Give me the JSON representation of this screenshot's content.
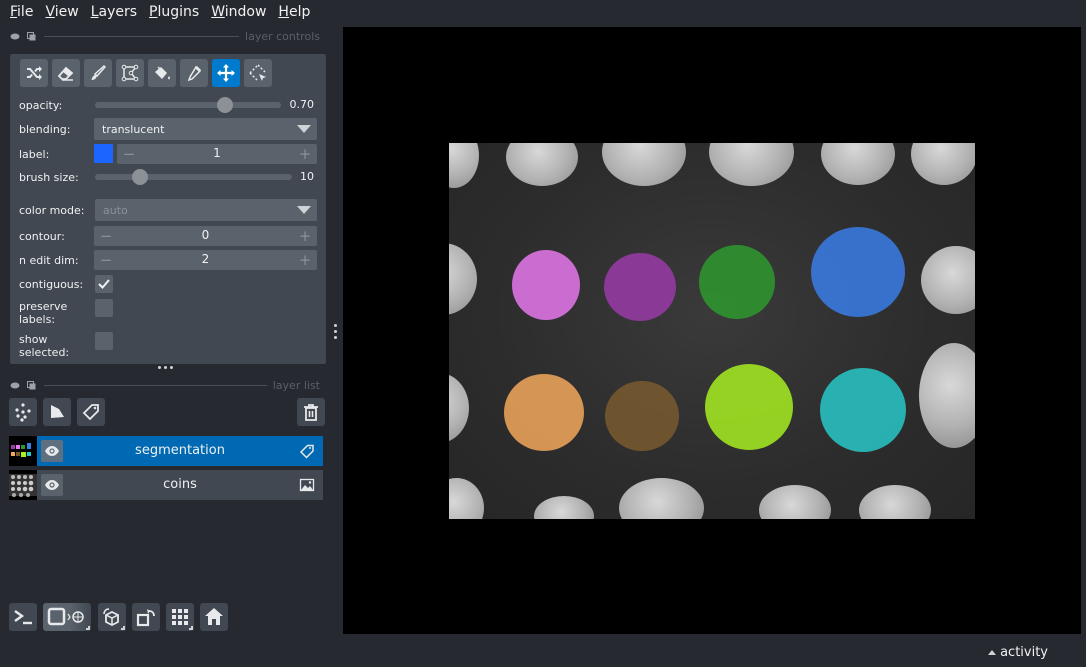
{
  "menubar": {
    "items": [
      {
        "mnemonic": "F",
        "rest": "ile"
      },
      {
        "mnemonic": "V",
        "rest": "iew"
      },
      {
        "mnemonic": "L",
        "rest": "ayers"
      },
      {
        "mnemonic": "P",
        "rest": "lugins"
      },
      {
        "mnemonic": "W",
        "rest": "indow"
      },
      {
        "mnemonic": "H",
        "rest": "elp"
      }
    ]
  },
  "layer_controls": {
    "title": "layer controls",
    "tools": [
      {
        "name": "shuffle-colors",
        "icon": "shuffle-icon",
        "active": false
      },
      {
        "name": "erase",
        "icon": "eraser-icon",
        "active": false
      },
      {
        "name": "paint",
        "icon": "paintbrush-icon",
        "active": false
      },
      {
        "name": "polygon",
        "icon": "polygon-icon",
        "active": false
      },
      {
        "name": "fill",
        "icon": "paint-bucket-icon",
        "active": false
      },
      {
        "name": "pick",
        "icon": "eyedropper-icon",
        "active": false
      },
      {
        "name": "pan-zoom",
        "icon": "move-arrows-icon",
        "active": true
      },
      {
        "name": "transform",
        "icon": "select-transform-icon",
        "active": false
      }
    ],
    "opacity": {
      "label": "opacity:",
      "value": 0.7,
      "display": "0.70"
    },
    "blending": {
      "label": "blending:",
      "value": "translucent"
    },
    "label": {
      "label": "label:",
      "value": "1",
      "color": "#1a66ff"
    },
    "brush_size": {
      "label": "brush size:",
      "value": 10,
      "min": 1,
      "max": 40,
      "display": "10"
    },
    "color_mode": {
      "label": "color mode:",
      "value": "auto"
    },
    "contour": {
      "label": "contour:",
      "value": "0"
    },
    "n_edit_dim": {
      "label": "n edit dim:",
      "value": "2"
    },
    "contiguous": {
      "label": "contiguous:",
      "checked": true
    },
    "preserve_labels": {
      "label_line1": "preserve",
      "label_line2": "labels:",
      "checked": false
    },
    "show_selected": {
      "label_line1": "show",
      "label_line2": "selected:",
      "checked": false
    }
  },
  "layer_list": {
    "title": "layer list",
    "buttons": [
      "new-points-layer",
      "new-shapes-layer",
      "new-labels-layer",
      "delete-layer"
    ],
    "layers": [
      {
        "name": "segmentation",
        "type": "labels",
        "visible": true,
        "selected": true
      },
      {
        "name": "coins",
        "type": "image",
        "visible": true,
        "selected": false
      }
    ]
  },
  "viewer_buttons": [
    "console",
    "toggle-2d-3d",
    "roll-dimensions",
    "transpose",
    "grid-mode",
    "reset-view"
  ],
  "status": {
    "activity_label": "activity"
  },
  "colors": {
    "accent": "#007acc",
    "selected_layer": "#0069b4",
    "background": "#262930",
    "panel": "#414851",
    "control": "#5a626c"
  },
  "segments": [
    {
      "label": 1,
      "color": "#e878f0"
    },
    {
      "label": 2,
      "color": "#9a3aa8"
    },
    {
      "label": 3,
      "color": "#2e9a2e"
    },
    {
      "label": 4,
      "color": "#3a7ee8"
    },
    {
      "label": 5,
      "color": "#f4a85c"
    },
    {
      "label": 6,
      "color": "#7a5a30"
    },
    {
      "label": 7,
      "color": "#a8f020"
    },
    {
      "label": 8,
      "color": "#28c8c8"
    }
  ]
}
